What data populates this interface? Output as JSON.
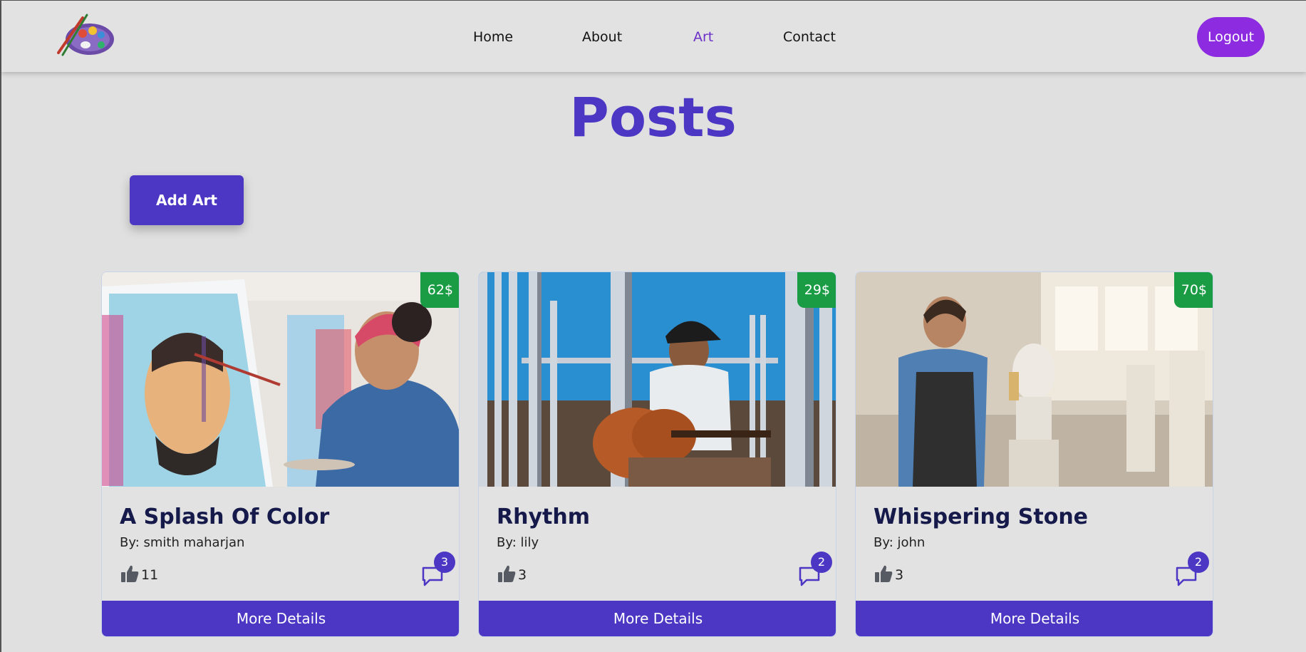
{
  "nav": {
    "logo": "palette-logo-icon",
    "links": [
      "Home",
      "About",
      "Art",
      "Contact"
    ],
    "active": "Art",
    "logout_label": "Logout",
    "accent_color": "#8c2bdf"
  },
  "main": {
    "title": "Posts",
    "add_art_label": "Add Art",
    "brand_color": "#4c37c4",
    "price_color": "#1a9c45"
  },
  "posts": [
    {
      "title": "A Splash Of Color",
      "author": "By: smith maharjan",
      "price": "62$",
      "likes": "11",
      "comments": "3",
      "more_label": "More Details",
      "image": "woman-painting-portrait-photo"
    },
    {
      "title": "Rhythm",
      "author": "By: lily",
      "price": "29$",
      "likes": "3",
      "comments": "2",
      "more_label": "More Details",
      "image": "man-playing-guitar-photo"
    },
    {
      "title": "Whispering Stone",
      "author": "By: john",
      "price": "70$",
      "likes": "3",
      "comments": "2",
      "more_label": "More Details",
      "image": "sculptor-carving-bust-photo"
    }
  ]
}
